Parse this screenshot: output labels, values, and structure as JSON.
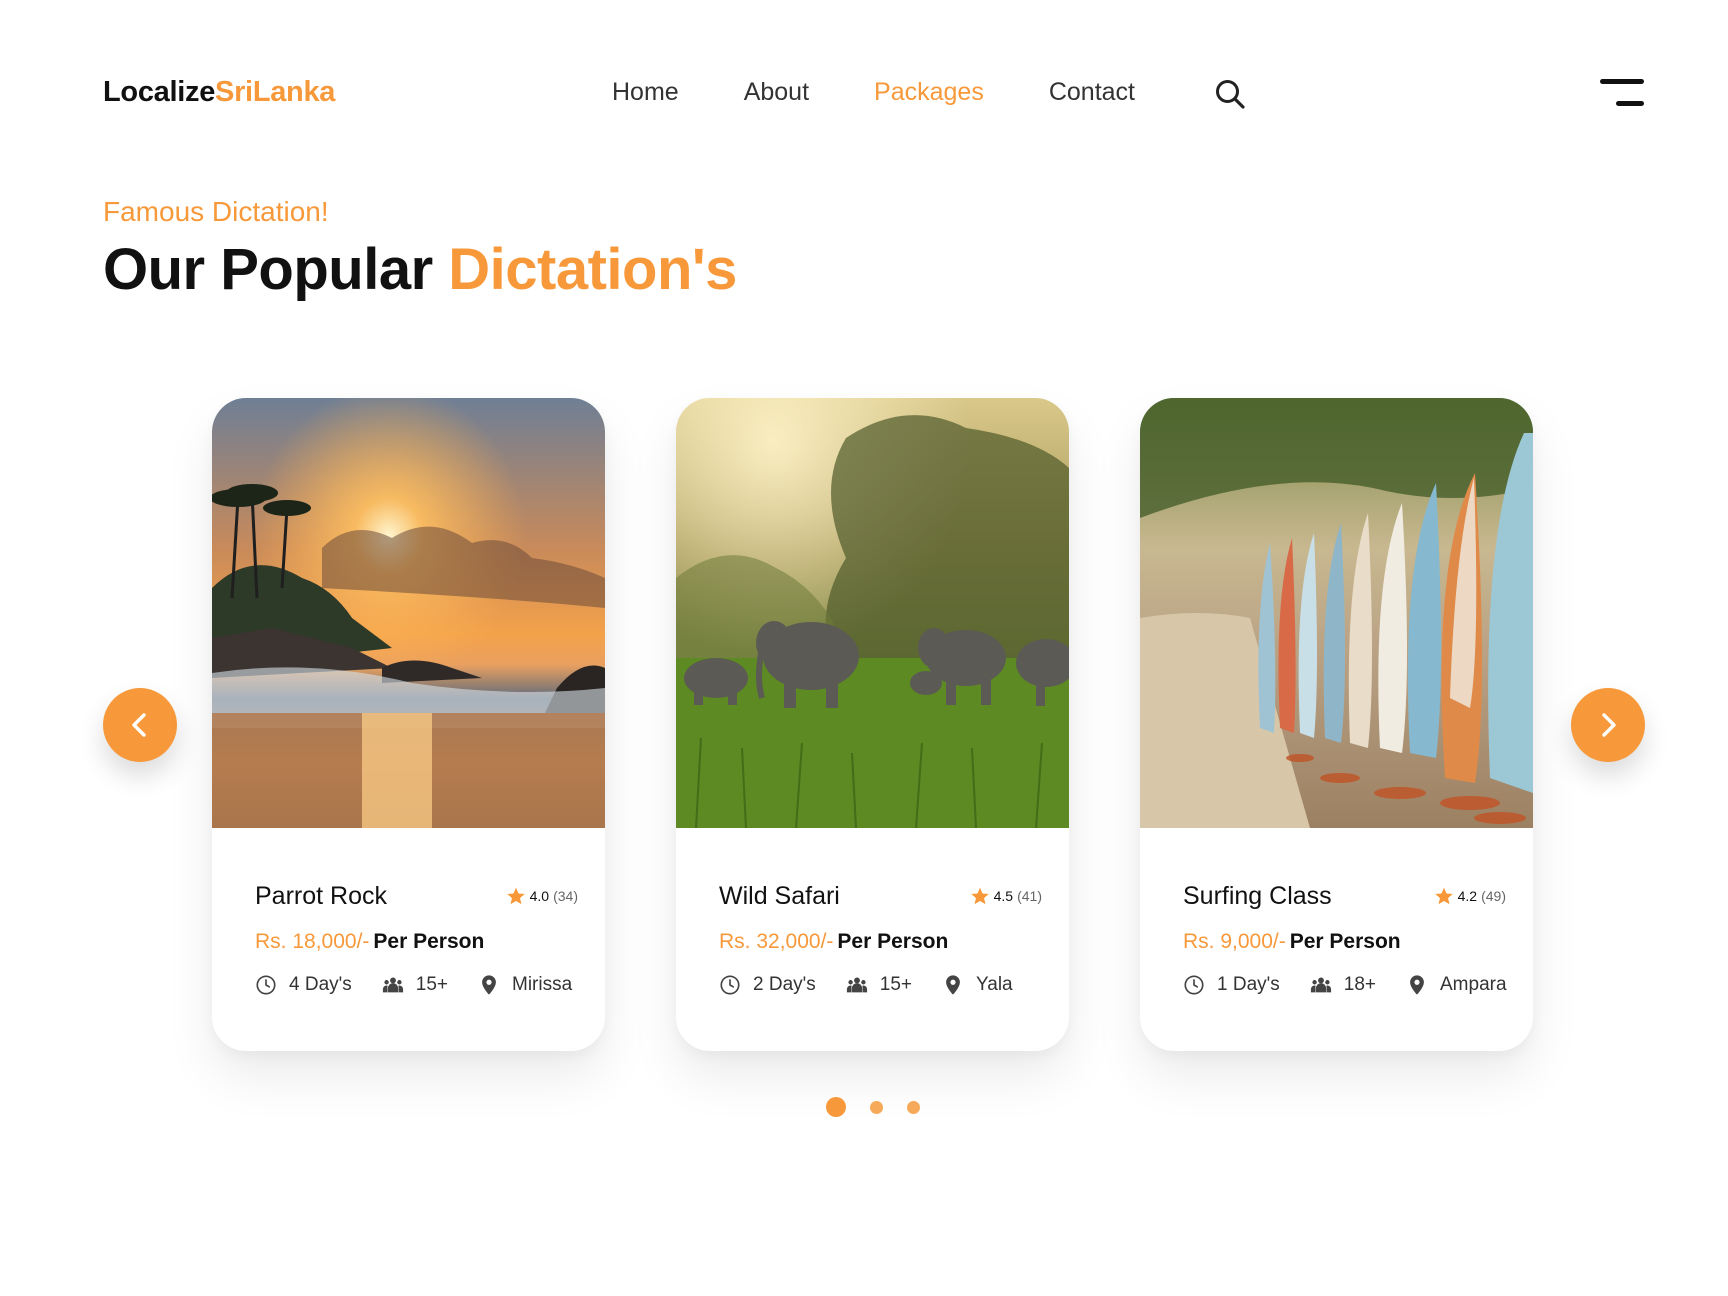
{
  "brand": {
    "part1": "Localize",
    "part2": "SriLanka"
  },
  "nav": {
    "items": [
      {
        "label": "Home"
      },
      {
        "label": "About"
      },
      {
        "label": "Packages"
      },
      {
        "label": "Contact"
      }
    ],
    "active": "Packages"
  },
  "section": {
    "eyebrow": "Famous Dictation!",
    "title_plain": "Our Popular ",
    "title_highlight": "Dictation's"
  },
  "cards": [
    {
      "name": "Parrot Rock",
      "rating": "4.0",
      "reviews": "(34)",
      "price": "Rs. 18,000/-",
      "price_unit": "Per Person",
      "duration": "4 Day's",
      "group": "15+",
      "location": "Mirissa",
      "image": "sunset-beach-rocks-photo"
    },
    {
      "name": "Wild Safari",
      "rating": "4.5",
      "reviews": "(41)",
      "price": "Rs. 32,000/-",
      "price_unit": "Per Person",
      "duration": "2 Day's",
      "group": "15+",
      "location": "Yala",
      "image": "elephants-grassland-photo"
    },
    {
      "name": "Surfing Class",
      "rating": "4.2",
      "reviews": "(49)",
      "price": "Rs. 9,000/-",
      "price_unit": "Per Person",
      "duration": "1 Day's",
      "group": "18+",
      "location": "Ampara",
      "image": "surfboards-beach-path-photo"
    }
  ],
  "carousel": {
    "pages": 3,
    "current": 1
  },
  "colors": {
    "accent": "#f7993a",
    "text": "#111111",
    "muted": "#333333"
  },
  "icons": [
    "search-icon",
    "menu-icon",
    "star-icon",
    "clock-icon",
    "group-icon",
    "location-pin-icon",
    "chevron-left-icon",
    "chevron-right-icon"
  ]
}
